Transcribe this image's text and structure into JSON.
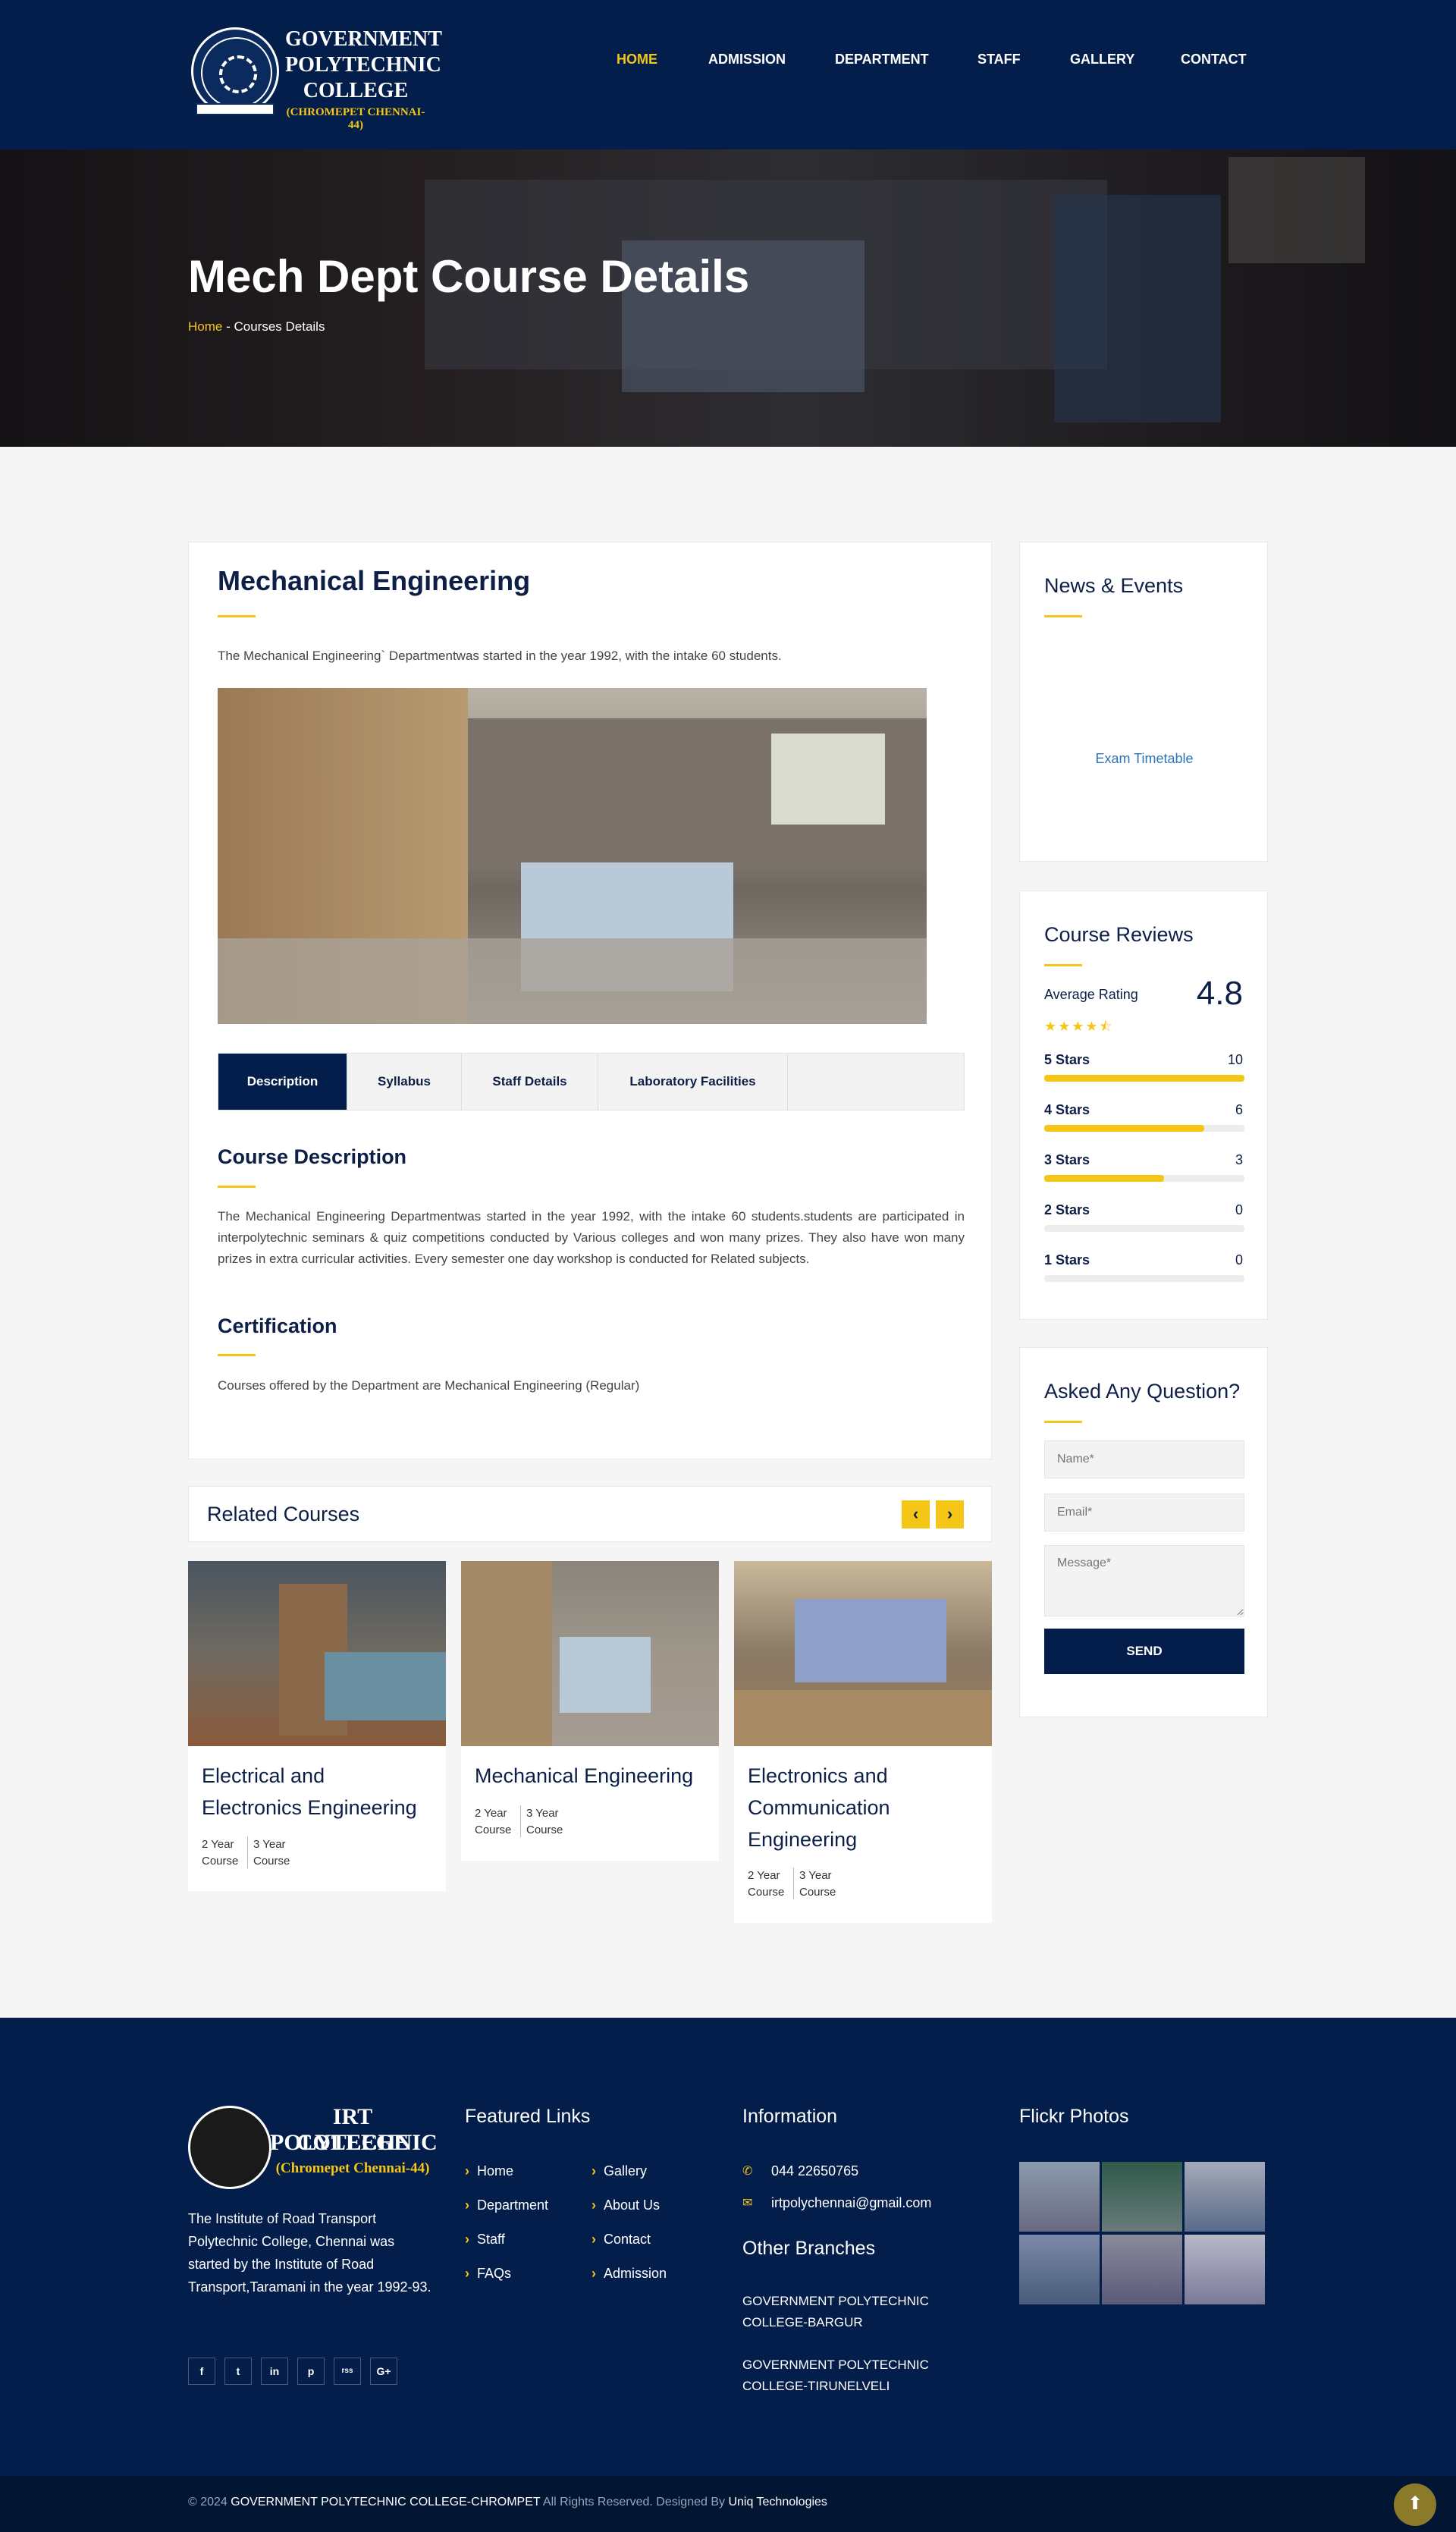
{
  "header": {
    "logo": {
      "line1": "GOVERNMENT",
      "line2": "POLYTECHNIC",
      "line3": "COLLEGE",
      "line4": "(CHROMEPET CHENNAI-44)"
    },
    "nav": [
      {
        "label": "HOME",
        "active": true
      },
      {
        "label": "ADMISSION",
        "active": false
      },
      {
        "label": "DEPARTMENT",
        "active": false
      },
      {
        "label": "STAFF",
        "active": false
      },
      {
        "label": "GALLERY",
        "active": false
      },
      {
        "label": "CONTACT",
        "active": false
      }
    ],
    "accent": "#f5c518",
    "background": "#031e4a"
  },
  "hero": {
    "title": "Mech Dept Course Details",
    "breadcrumb_home": "Home",
    "breadcrumb_sep": " - ",
    "breadcrumb_current": "Courses Details"
  },
  "main": {
    "title": "Mechanical Engineering",
    "intro": "The Mechanical Engineering` Departmentwas started in the year 1992, with the intake 60 students.",
    "tabs": [
      "Description",
      "Syllabus",
      "Staff Details",
      "Laboratory Facilities"
    ],
    "description_heading": "Course Description",
    "description_text": "The Mechanical Engineering Departmentwas started in the year 1992, with the intake 60 students.students are participated in interpolytechnic seminars & quiz competitions conducted by Various colleges and won many prizes. They also have won many prizes in extra curricular activities. Every semester one day workshop is conducted for Related subjects.",
    "certification_heading": "Certification",
    "certification_text": "Courses offered by the Department are Mechanical Engineering (Regular)"
  },
  "related": {
    "heading": "Related Courses",
    "prev_icon": "‹",
    "next_icon": "›",
    "courses": [
      {
        "title": "Electrical and Electronics Engineering",
        "a1": "2 Year",
        "a2": "Course",
        "b1": "3 Year",
        "b2": "Course"
      },
      {
        "title": "Mechanical Engineering",
        "a1": "2 Year",
        "a2": "Course",
        "b1": "3 Year",
        "b2": "Course"
      },
      {
        "title": "Electronics and Communication Engineering",
        "a1": "2 Year",
        "a2": "Course",
        "b1": "3 Year",
        "b2": "Course"
      }
    ]
  },
  "sidebar": {
    "news_heading": "News & Events",
    "news_link": "Exam Timetable",
    "reviews_heading": "Course Reviews",
    "average_label": "Average Rating",
    "average_value": "4.8",
    "stars_icon": "★★★★⯪",
    "ratings": [
      {
        "label": "5 Stars",
        "count": "10",
        "fill": 1.0
      },
      {
        "label": "4 Stars",
        "count": "6",
        "fill": 0.8
      },
      {
        "label": "3 Stars",
        "count": "3",
        "fill": 0.6
      },
      {
        "label": "2 Stars",
        "count": "0",
        "fill": 0
      },
      {
        "label": "1 Stars",
        "count": "0",
        "fill": 0
      }
    ],
    "question_heading": "Asked Any Question?",
    "name_placeholder": "Name*",
    "email_placeholder": "Email*",
    "message_placeholder": "Message*",
    "send_label": "SEND"
  },
  "footer": {
    "logo": {
      "line1": "IRT POLYTECHNIC",
      "line2": "COLLEGE",
      "line3": "(Chromepet Chennai-44)"
    },
    "about": "The Institute of Road Transport Polytechnic College, Chennai was started by the Institute of Road Transport,Taramani in the year 1992-93.",
    "social": [
      "f",
      "t",
      "in",
      "p",
      "rss",
      "G+"
    ],
    "featured_heading": "Featured Links",
    "links_col1": [
      "Home",
      "Department",
      "Staff",
      "FAQs"
    ],
    "links_col2": [
      "Gallery",
      "About Us",
      "Contact",
      "Admission"
    ],
    "info_heading": "Information",
    "phone": "044 22650765",
    "email": "irtpolychennai@gmail.com",
    "branches_heading": "Other Branches",
    "branch1": "GOVERNMENT POLYTECHNIC COLLEGE-BARGUR",
    "branch2": "GOVERNMENT POLYTECHNIC COLLEGE-TIRUNELVELI",
    "flickr_heading": "Flickr Photos"
  },
  "copyright": {
    "prefix": "© 2024 ",
    "college": "GOVERNMENT POLYTECHNIC COLLEGE-CHROMPET",
    "rights": " All Rights Reserved.   Designed By ",
    "designer": "Uniq Technologies"
  }
}
